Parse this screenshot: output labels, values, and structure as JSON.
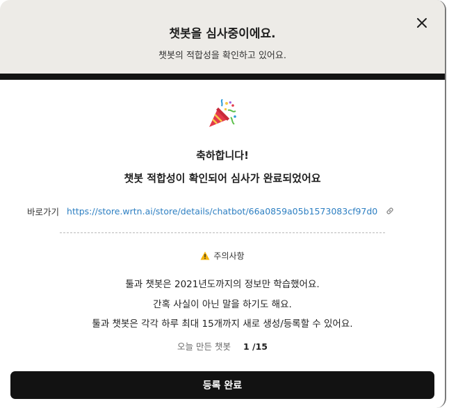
{
  "header": {
    "title": "챗봇을 심사중이에요.",
    "subtitle": "챗봇의 적합성을 확인하고 있어요."
  },
  "icons": {
    "close": "close-icon",
    "celebration": "party-popper-icon",
    "link": "link-icon",
    "warning": "warning-icon"
  },
  "result": {
    "title": "축하합니다!",
    "message": "챗봇 적합성이 확인되어 심사가 완료되었어요"
  },
  "shortcut": {
    "label": "바로가기",
    "url": "https://store.wrtn.ai/store/details/chatbot/66a0859a05b1573083cf97d0"
  },
  "notice": {
    "title": "주의사항",
    "lines": [
      "툴과 챗봇은 2021년도까지의 정보만 학습했어요.",
      "간혹 사실이 아닌 말을 하기도 해요.",
      "툴과 챗봇은 각각 하루 최대 15개까지 새로 생성/등록할 수 있어요."
    ]
  },
  "daily_count": {
    "label": "오늘 만든 챗봇",
    "value": "1 /15"
  },
  "actions": {
    "confirm_label": "등록 완료"
  },
  "colors": {
    "header_bg": "#edebe7",
    "dark": "#121212",
    "link": "#2d7fc2",
    "warning": "#f5b40c"
  }
}
